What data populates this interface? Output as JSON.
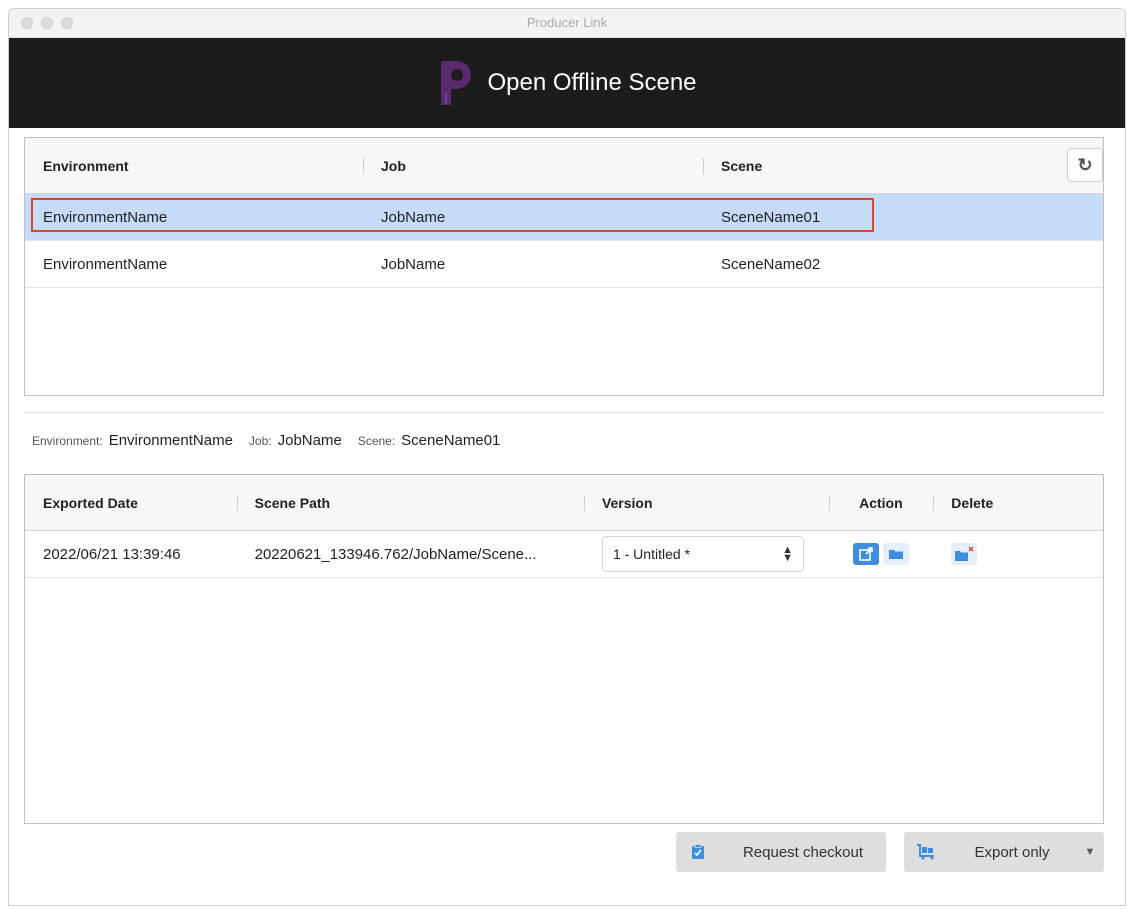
{
  "window": {
    "title": "Producer Link"
  },
  "banner": {
    "title": "Open Offline Scene"
  },
  "env_table": {
    "headers": {
      "environment": "Environment",
      "job": "Job",
      "scene": "Scene"
    },
    "rows": [
      {
        "environment": "EnvironmentName",
        "job": "JobName",
        "scene": "SceneName01",
        "selected": true
      },
      {
        "environment": "EnvironmentName",
        "job": "JobName",
        "scene": "SceneName02",
        "selected": false
      }
    ],
    "refresh_icon": "refresh-icon"
  },
  "summary": {
    "env_key": "Environment:",
    "env_val": "EnvironmentName",
    "job_key": "Job:",
    "job_val": "JobName",
    "scene_key": "Scene:",
    "scene_val": "SceneName01"
  },
  "export_table": {
    "headers": {
      "date": "Exported Date",
      "path": "Scene Path",
      "version": "Version",
      "action": "Action",
      "delete": "Delete"
    },
    "rows": [
      {
        "date": "2022/06/21 13:39:46",
        "path": "20220621_133946.762/JobName/Scene...",
        "version": "1 - Untitled *"
      }
    ]
  },
  "buttons": {
    "request_checkout": "Request checkout",
    "export_only": "Export only"
  },
  "colors": {
    "selected_row": "#c5dbf7",
    "highlight_border": "#d9452d",
    "accent": "#3d8ee0",
    "banner_bg": "#1c1c1c",
    "logo": "#5a2a6e"
  }
}
